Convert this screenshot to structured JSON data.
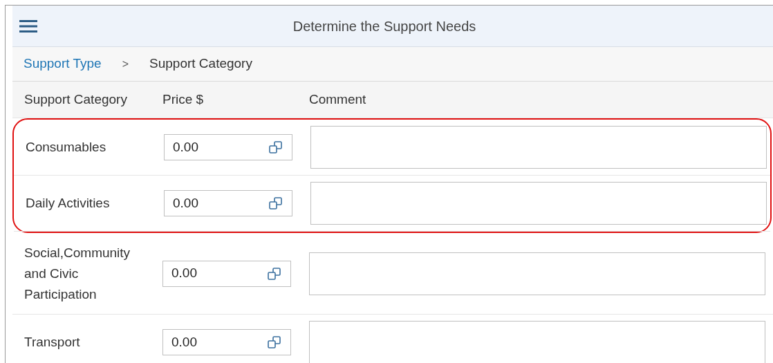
{
  "header": {
    "title": "Determine the Support Needs"
  },
  "breadcrumb": [
    {
      "label": "Support Type",
      "kind": "link"
    },
    {
      "label": ">",
      "kind": "separator"
    },
    {
      "label": "Support Category",
      "kind": "current"
    }
  ],
  "table": {
    "columns": [
      "Support Category",
      "Price $",
      "Comment"
    ],
    "rows": [
      {
        "category": "Consumables",
        "price": "0.00",
        "highlighted": true
      },
      {
        "category": "Daily Activities",
        "price": "0.00",
        "highlighted": true
      },
      {
        "category": "Social,Community and Civic Participation",
        "price": "0.00",
        "highlighted": false
      },
      {
        "category": "Transport",
        "price": "0.00",
        "highlighted": false
      }
    ]
  }
}
